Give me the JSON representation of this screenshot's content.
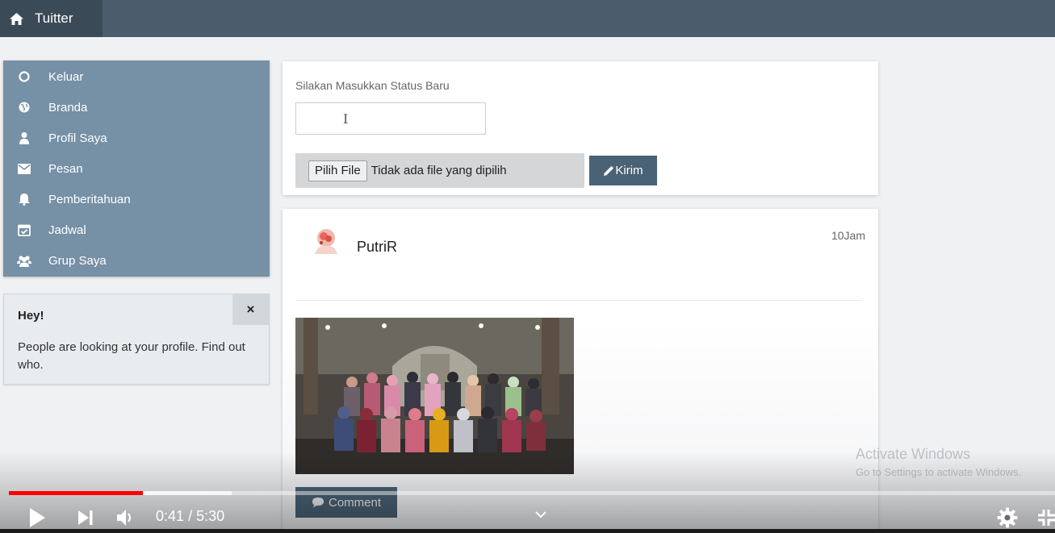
{
  "app": {
    "brand": "Tuitter",
    "icon": "home-icon"
  },
  "sidebar": {
    "items": [
      {
        "label": "Keluar",
        "icon": "circle-icon"
      },
      {
        "label": "Branda",
        "icon": "globe-icon"
      },
      {
        "label": "Profil Saya",
        "icon": "user-icon"
      },
      {
        "label": "Pesan",
        "icon": "envelope-icon"
      },
      {
        "label": "Pemberitahuan",
        "icon": "bell-icon"
      },
      {
        "label": "Jadwal",
        "icon": "calendar-check-icon"
      },
      {
        "label": "Grup Saya",
        "icon": "users-icon"
      }
    ]
  },
  "alert": {
    "title": "Hey!",
    "text": "People are looking at your profile. Find out who.",
    "close": "×"
  },
  "status": {
    "label": "Silakan Masukkan Status Baru",
    "input_value": "",
    "file_button": "Pilih File",
    "file_text": "Tidak ada file yang dipilih",
    "submit": "Kirim"
  },
  "post": {
    "user": "PutriR",
    "time": "10Jam",
    "comment_button": "Comment"
  },
  "watermark": {
    "title": "Activate Windows",
    "subtitle": "Go to Settings to activate Windows."
  },
  "player": {
    "current_time": "0:41",
    "separator": "/",
    "duration": "5:30",
    "played_fraction": 0.128,
    "buffered_fraction": 0.213
  },
  "colors": {
    "topbar": "#4b5d6d",
    "sidebar": "#7690a6",
    "button": "#4a6275",
    "progress": "#ff0000"
  }
}
